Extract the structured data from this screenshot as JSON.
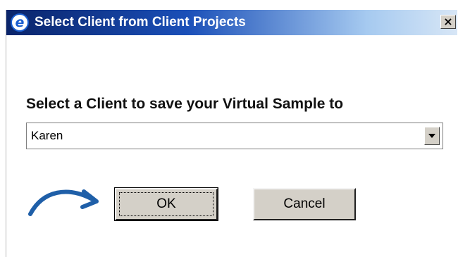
{
  "dialog": {
    "title": "Select Client from Client Projects",
    "close_glyph": "×",
    "icon": "e-logo-icon"
  },
  "prompt": "Select a Client to save your Virtual Sample to",
  "client_select": {
    "selected_value": "Karen"
  },
  "buttons": {
    "ok_label": "OK",
    "cancel_label": "Cancel"
  },
  "annotation": {
    "icon": "curved-arrow-icon",
    "color": "#1f5fa8"
  }
}
